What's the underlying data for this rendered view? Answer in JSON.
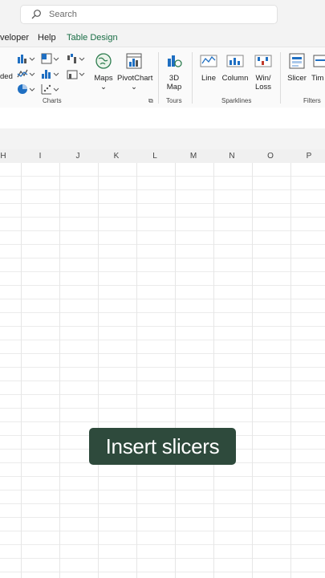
{
  "search": {
    "placeholder": "Search"
  },
  "menu": {
    "developer": "veloper",
    "help": "Help",
    "table_design": "Table Design"
  },
  "ribbon": {
    "left_cut": "ded",
    "charts_group": "Charts",
    "maps": "Maps",
    "pivotchart": "PivotChart",
    "map3d_line1": "3D",
    "map3d_line2": "Map",
    "tours_group": "Tours",
    "line": "Line",
    "column": "Column",
    "winloss_line1": "Win/",
    "winloss_line2": "Loss",
    "sparklines_group": "Sparklines",
    "slicer": "Slicer",
    "timeline_cut": "Tim",
    "filters_group": "Filters"
  },
  "columns": [
    "H",
    "I",
    "J",
    "K",
    "L",
    "M",
    "N",
    "O",
    "P"
  ],
  "caption": "Insert slicers",
  "colors": {
    "accent": "#1a6e46",
    "caption_bg": "#2e4a3c"
  }
}
